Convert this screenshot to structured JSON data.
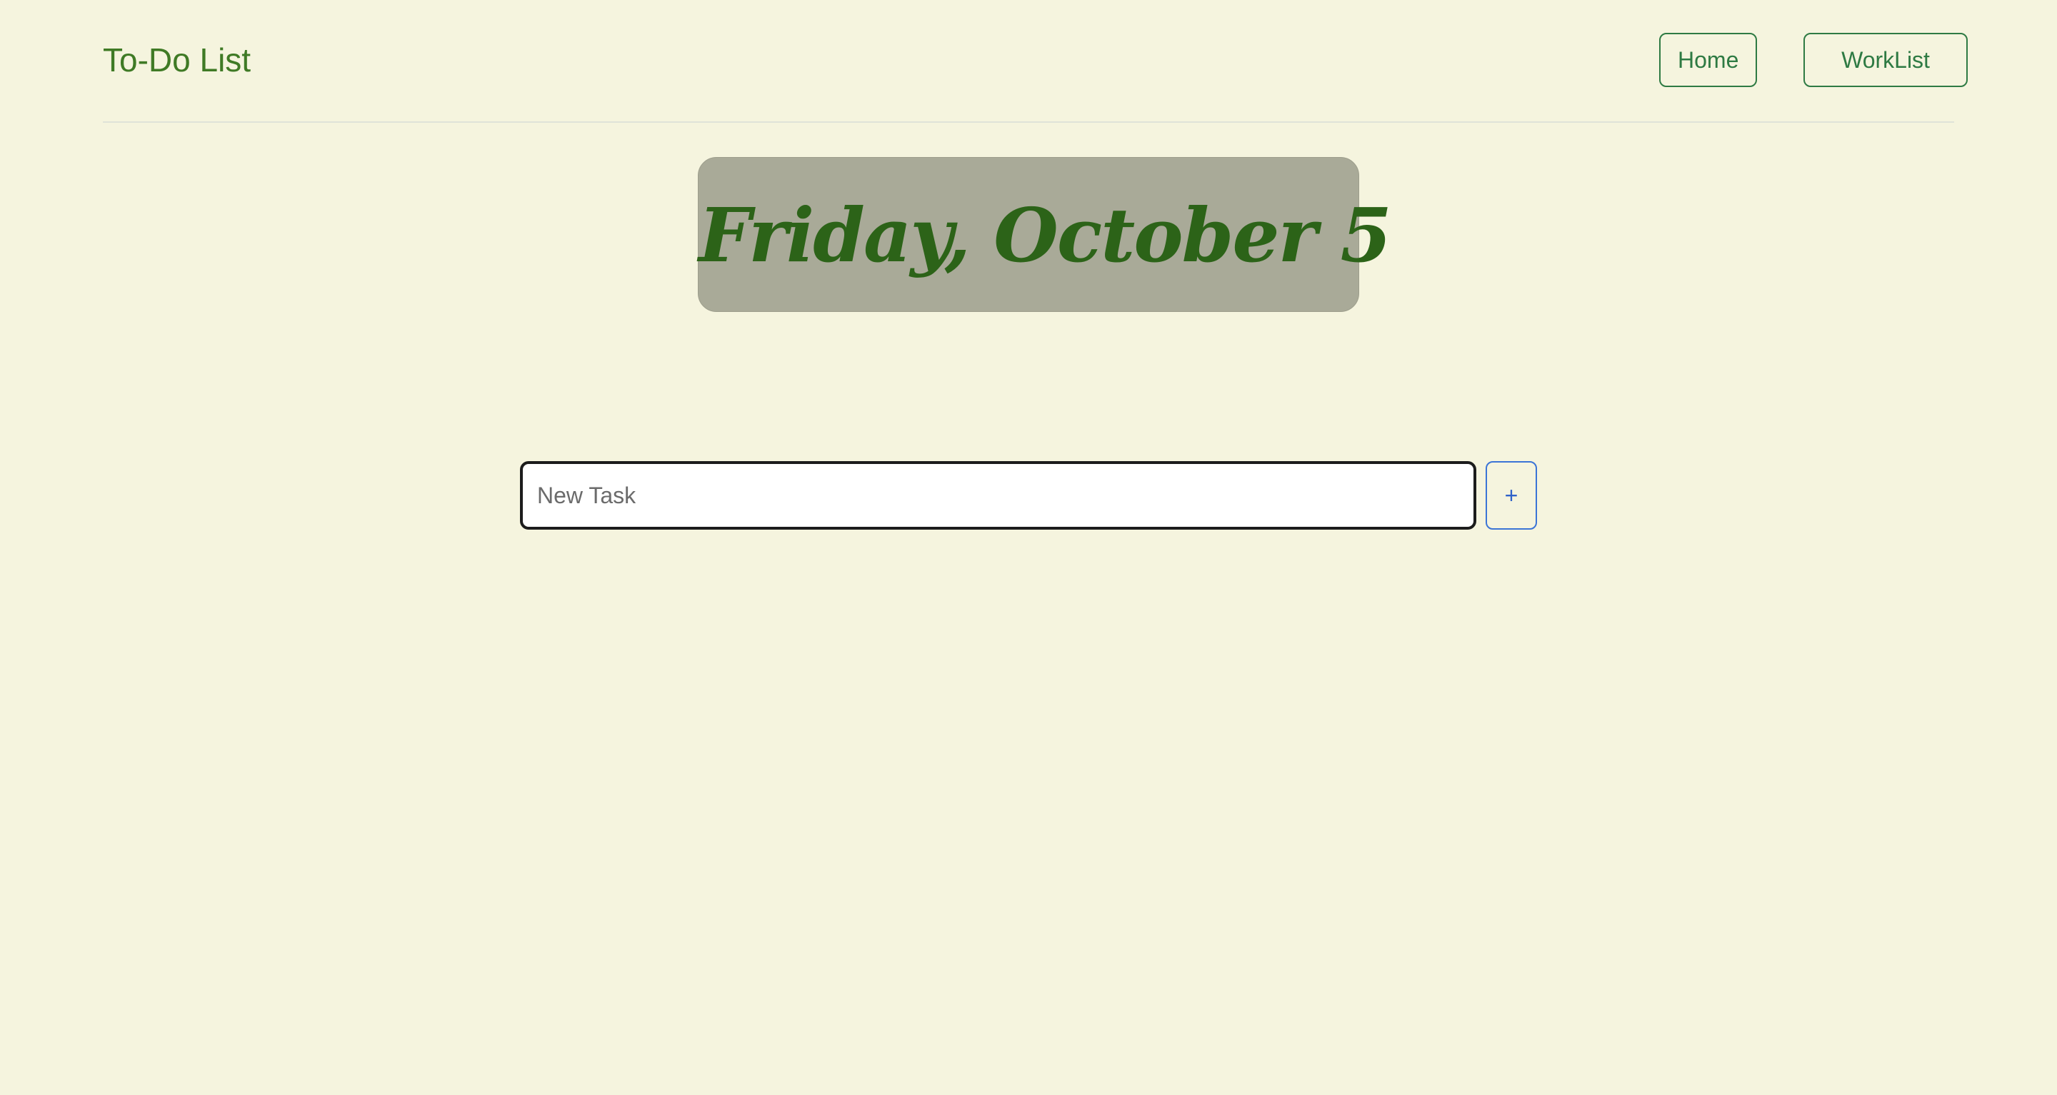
{
  "navbar": {
    "brand": "To-Do List",
    "links": [
      {
        "label": "Home"
      },
      {
        "label": "WorkList"
      }
    ]
  },
  "header": {
    "date_title": "Friday, October 5"
  },
  "task_form": {
    "input_placeholder": "New Task",
    "input_value": "",
    "add_label": "+"
  },
  "colors": {
    "background": "#f5f4de",
    "brand": "#3f7a25",
    "nav_button": "#2e7a43",
    "date_box": "#a9aa98",
    "date_text": "#2c6318",
    "add_button": "#3b74d6"
  }
}
